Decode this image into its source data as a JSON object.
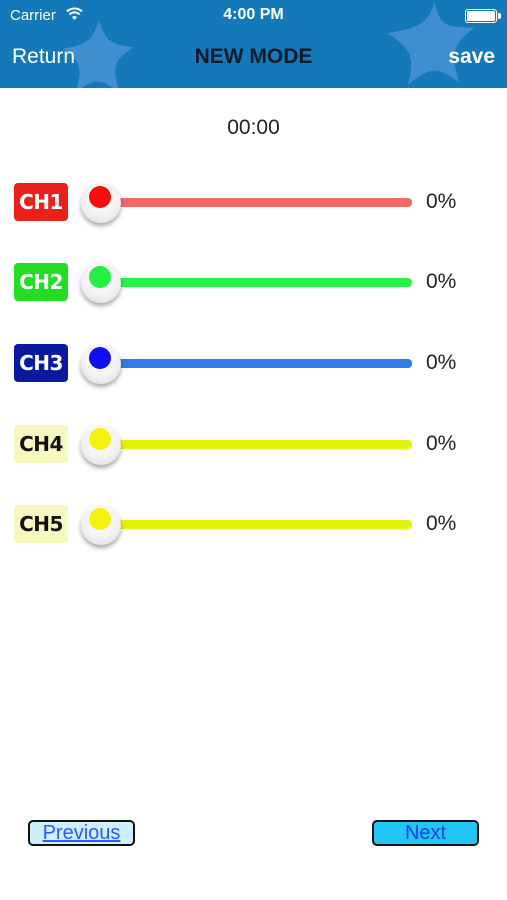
{
  "status_bar": {
    "carrier": "Carrier",
    "time": "4:00 PM",
    "icons": [
      "wifi-icon",
      "battery-icon"
    ]
  },
  "nav": {
    "back_label": "Return",
    "title": "NEW MODE",
    "save_label": "save",
    "bar_color": "#1479b8"
  },
  "timer": "00:00",
  "channels": [
    {
      "label": "CH1",
      "percent_text": "0%",
      "value": 0,
      "badge_bg": "#e8211a",
      "badge_fg": "#ffffff",
      "track_color": "#f06a6a",
      "dot_color": "#ff0a0a"
    },
    {
      "label": "CH2",
      "percent_text": "0%",
      "value": 0,
      "badge_bg": "#22dd22",
      "badge_fg": "#ffffff",
      "track_color": "#2af04a",
      "dot_color": "#22ee44"
    },
    {
      "label": "CH3",
      "percent_text": "0%",
      "value": 0,
      "badge_bg": "#0a1aa0",
      "badge_fg": "#ffffff",
      "track_color": "#2f7be8",
      "dot_color": "#1010ee"
    },
    {
      "label": "CH4",
      "percent_text": "0%",
      "value": 0,
      "badge_bg": "#f7f7c0",
      "badge_fg": "#111111",
      "track_color": "#dff40a",
      "dot_color": "#f3f311"
    },
    {
      "label": "CH5",
      "percent_text": "0%",
      "value": 0,
      "badge_bg": "#f7f7c0",
      "badge_fg": "#111111",
      "track_color": "#dff40a",
      "dot_color": "#f3f311"
    }
  ],
  "buttons": {
    "previous_label": "Previous",
    "next_label": "Next"
  }
}
